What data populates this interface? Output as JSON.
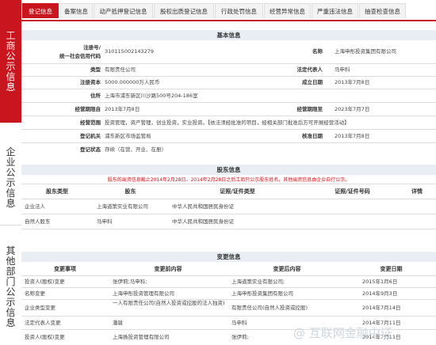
{
  "sidebar": {
    "section1": "工商公示信息",
    "section2": "企业公示信息",
    "section3": "其他部门公示信息"
  },
  "tabs": [
    {
      "label": "登记信息",
      "active": true
    },
    {
      "label": "备案信息",
      "active": false
    },
    {
      "label": "动产抵押登记信息",
      "active": false
    },
    {
      "label": "股权出质登记信息",
      "active": false
    },
    {
      "label": "行政处罚信息",
      "active": false
    },
    {
      "label": "经营异常信息",
      "active": false
    },
    {
      "label": "严重违法信息",
      "active": false
    },
    {
      "label": "抽查检查信息",
      "active": false
    }
  ],
  "basic": {
    "title": "基本信息",
    "reg_no_label1": "注册号/",
    "reg_no_label2": "统一社会信用代码",
    "reg_no": "310115002143279",
    "name_label": "名称",
    "name": "上海申彤投资集团有限公司",
    "type_label": "类型",
    "type": "有限责任公司",
    "legal_rep_label": "法定代表人",
    "legal_rep": "马申科",
    "capital_label": "注册资本",
    "capital": "5000.000000万人民币",
    "est_date_label": "成立日期",
    "est_date": "2013年7月8日",
    "address_label": "住所",
    "address": "上海市浦东新区川沙路500号204-186室",
    "term_from_label": "经营期限自",
    "term_from": "2013年7月8日",
    "term_to_label": "经营期限至",
    "term_to": "2023年7月7日",
    "scope_label": "经营范围",
    "scope": "投资管理，资产管理，创业投资，实业投资。【依法须经批准的项目，经相关部门批准后方可开展经营活动】",
    "authority_label": "登记机关",
    "authority": "浦东新区市场监管局",
    "approval_label": "核准日期",
    "approval": "2013年7月8日",
    "status_label": "登记状态",
    "status": "存续（在营、开业、在册）"
  },
  "shareholders": {
    "title": "股东信息",
    "notice": "股东的出资信息截止2014年2月28日。2014年2月28日之后工商只公示股东姓名，其他出资信息由企业自行公示。",
    "headers": [
      "股东类型",
      "股东",
      "证照/证件类型",
      "证照/证件号码",
      "详情"
    ],
    "rows": [
      [
        "企业法人",
        "上海道策实业有限公司",
        "中华人民共和国居民身份证",
        "",
        ""
      ],
      [
        "自然人股东",
        "马申科",
        "中华人民共和国居民身份证",
        "",
        ""
      ]
    ]
  },
  "changes": {
    "title": "变更信息",
    "headers": [
      "变更事项",
      "变更前内容",
      "变更后内容",
      "变更日期"
    ],
    "rows": [
      [
        "投资人(股权)变更",
        "张伊莉;马申科;",
        "上海道策实业有限公司;",
        "2015年1月6日"
      ],
      [
        "名称变更",
        "上海申彤投资管理有限公司",
        "上海申彤投资集团有限公司",
        "2014年9月3日"
      ],
      [
        "企业类型变更",
        "一人有限责任公司(自然人投资或控股的法人独资)",
        "有限责任公司(自然人投资或控股)",
        "2014年7月14日"
      ],
      [
        "法定代表人变更",
        "潘骏",
        "马申科",
        "2014年7月11日"
      ],
      [
        "投资人(股权)变更",
        "上海扬投资管理有限公司",
        "张伊莉;",
        "2014年7月11日"
      ]
    ]
  },
  "watermark": "@ 互联网金融中证"
}
